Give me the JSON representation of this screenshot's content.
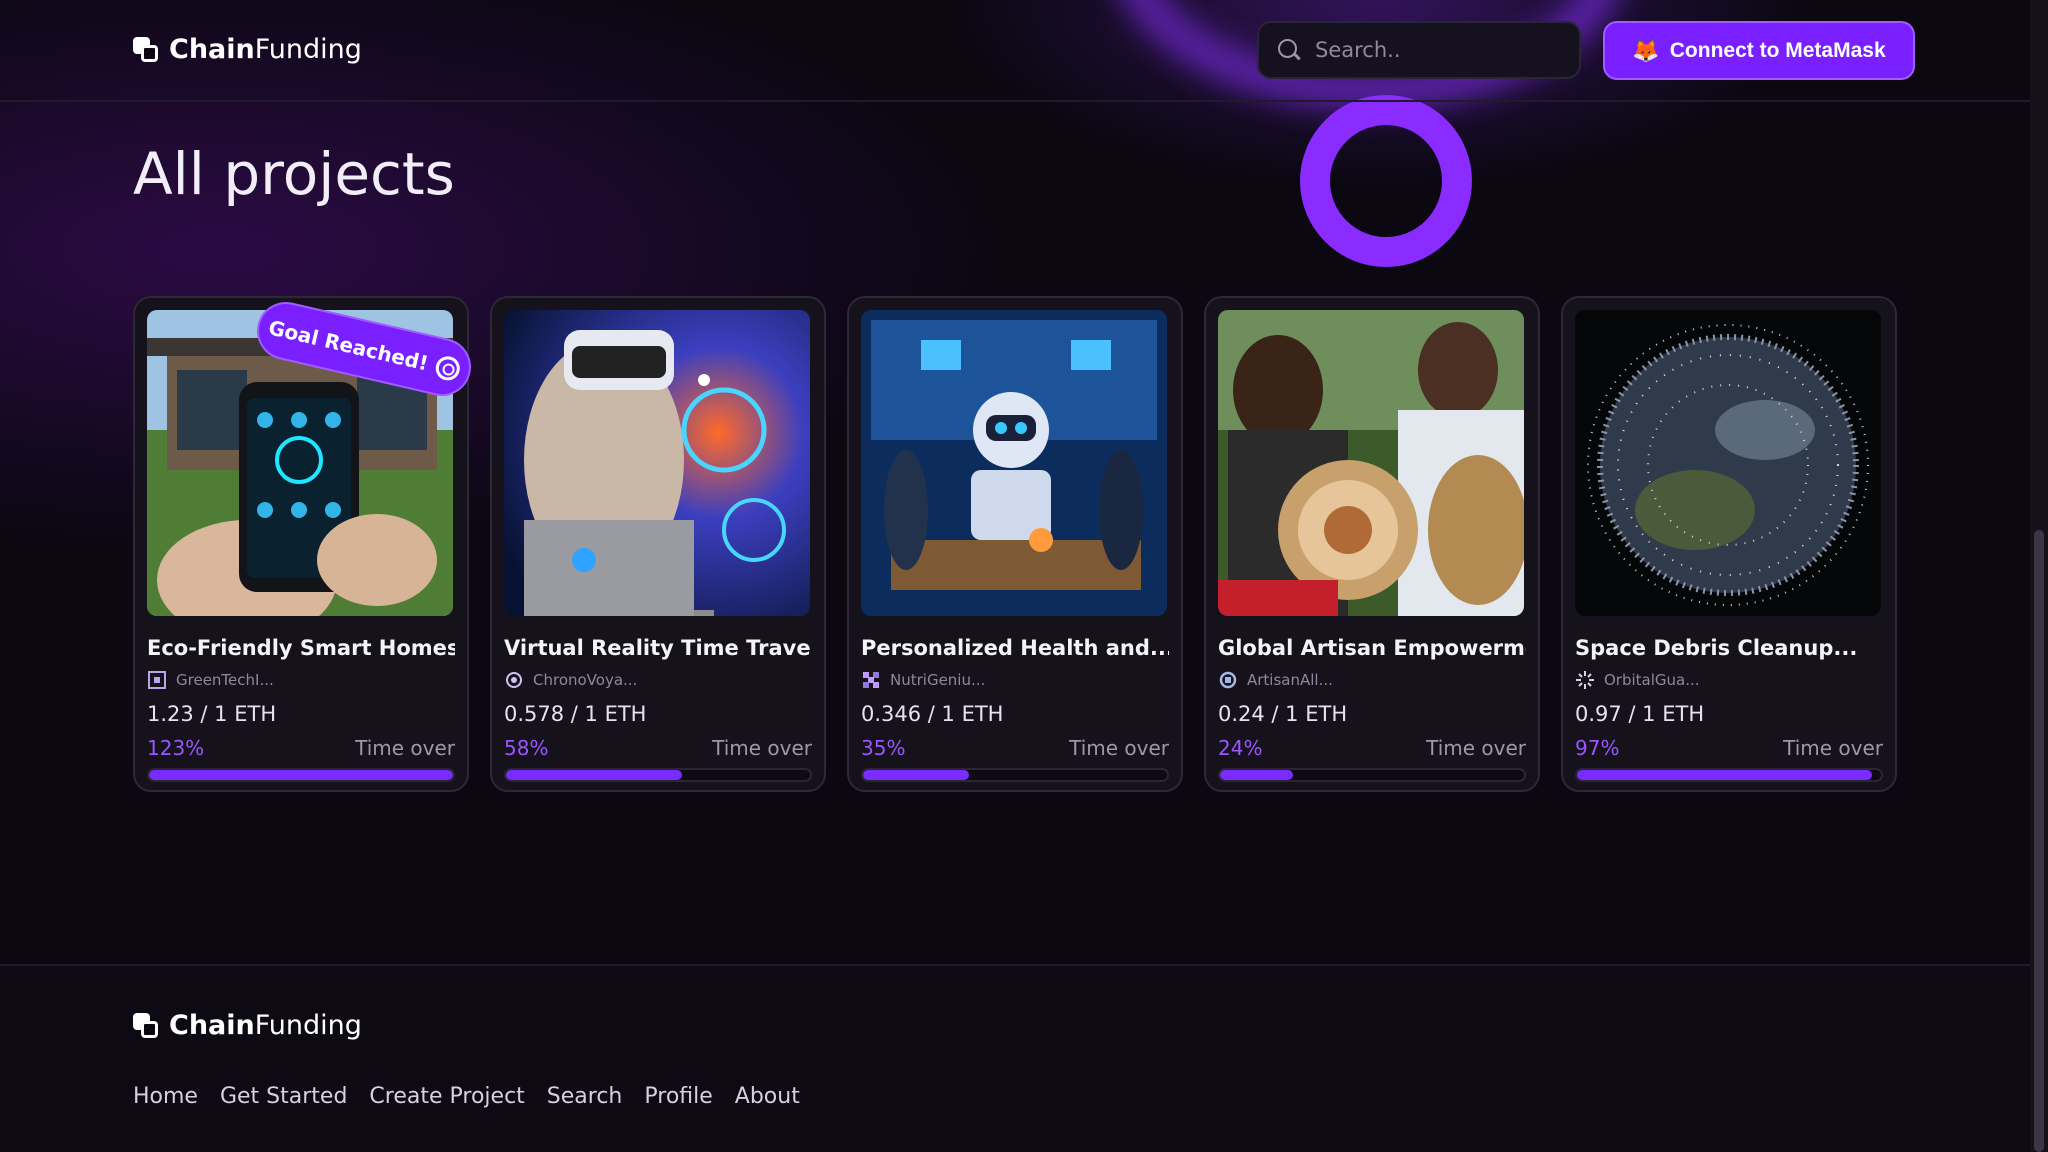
{
  "header": {
    "brand_bold": "Chain",
    "brand_light": "Funding",
    "search_placeholder": "Search..",
    "connect_label": "Connect to MetaMask",
    "connect_icon": "metamask-fox-icon"
  },
  "main": {
    "title": "All projects",
    "goal_badge": "Goal Reached!",
    "projects": [
      {
        "title": "Eco-Friendly Smart Homes",
        "creator": "GreenTechI...",
        "funding": "1.23 / 1 ETH",
        "percent_label": "123%",
        "percent": 100,
        "status": "Time over",
        "goal_reached": true
      },
      {
        "title": "Virtual Reality Time Travel...",
        "creator": "ChronoVoya...",
        "funding": "0.578 / 1 ETH",
        "percent_label": "58%",
        "percent": 58,
        "status": "Time over",
        "goal_reached": false
      },
      {
        "title": "Personalized Health and...",
        "creator": "NutriGeniu...",
        "funding": "0.346 / 1 ETH",
        "percent_label": "35%",
        "percent": 35,
        "status": "Time over",
        "goal_reached": false
      },
      {
        "title": "Global Artisan Empowerme...",
        "creator": "ArtisanAll...",
        "funding": "0.24 / 1 ETH",
        "percent_label": "24%",
        "percent": 24,
        "status": "Time over",
        "goal_reached": false
      },
      {
        "title": "Space Debris Cleanup...",
        "creator": "OrbitalGua...",
        "funding": "0.97 / 1 ETH",
        "percent_label": "97%",
        "percent": 97,
        "status": "Time over",
        "goal_reached": false
      }
    ]
  },
  "footer": {
    "brand_bold": "Chain",
    "brand_light": "Funding",
    "links": [
      "Home",
      "Get Started",
      "Create Project",
      "Search",
      "Profile",
      "About"
    ]
  },
  "colors": {
    "accent": "#7a1fff",
    "background": "#0b0812",
    "card": "#15121c"
  }
}
